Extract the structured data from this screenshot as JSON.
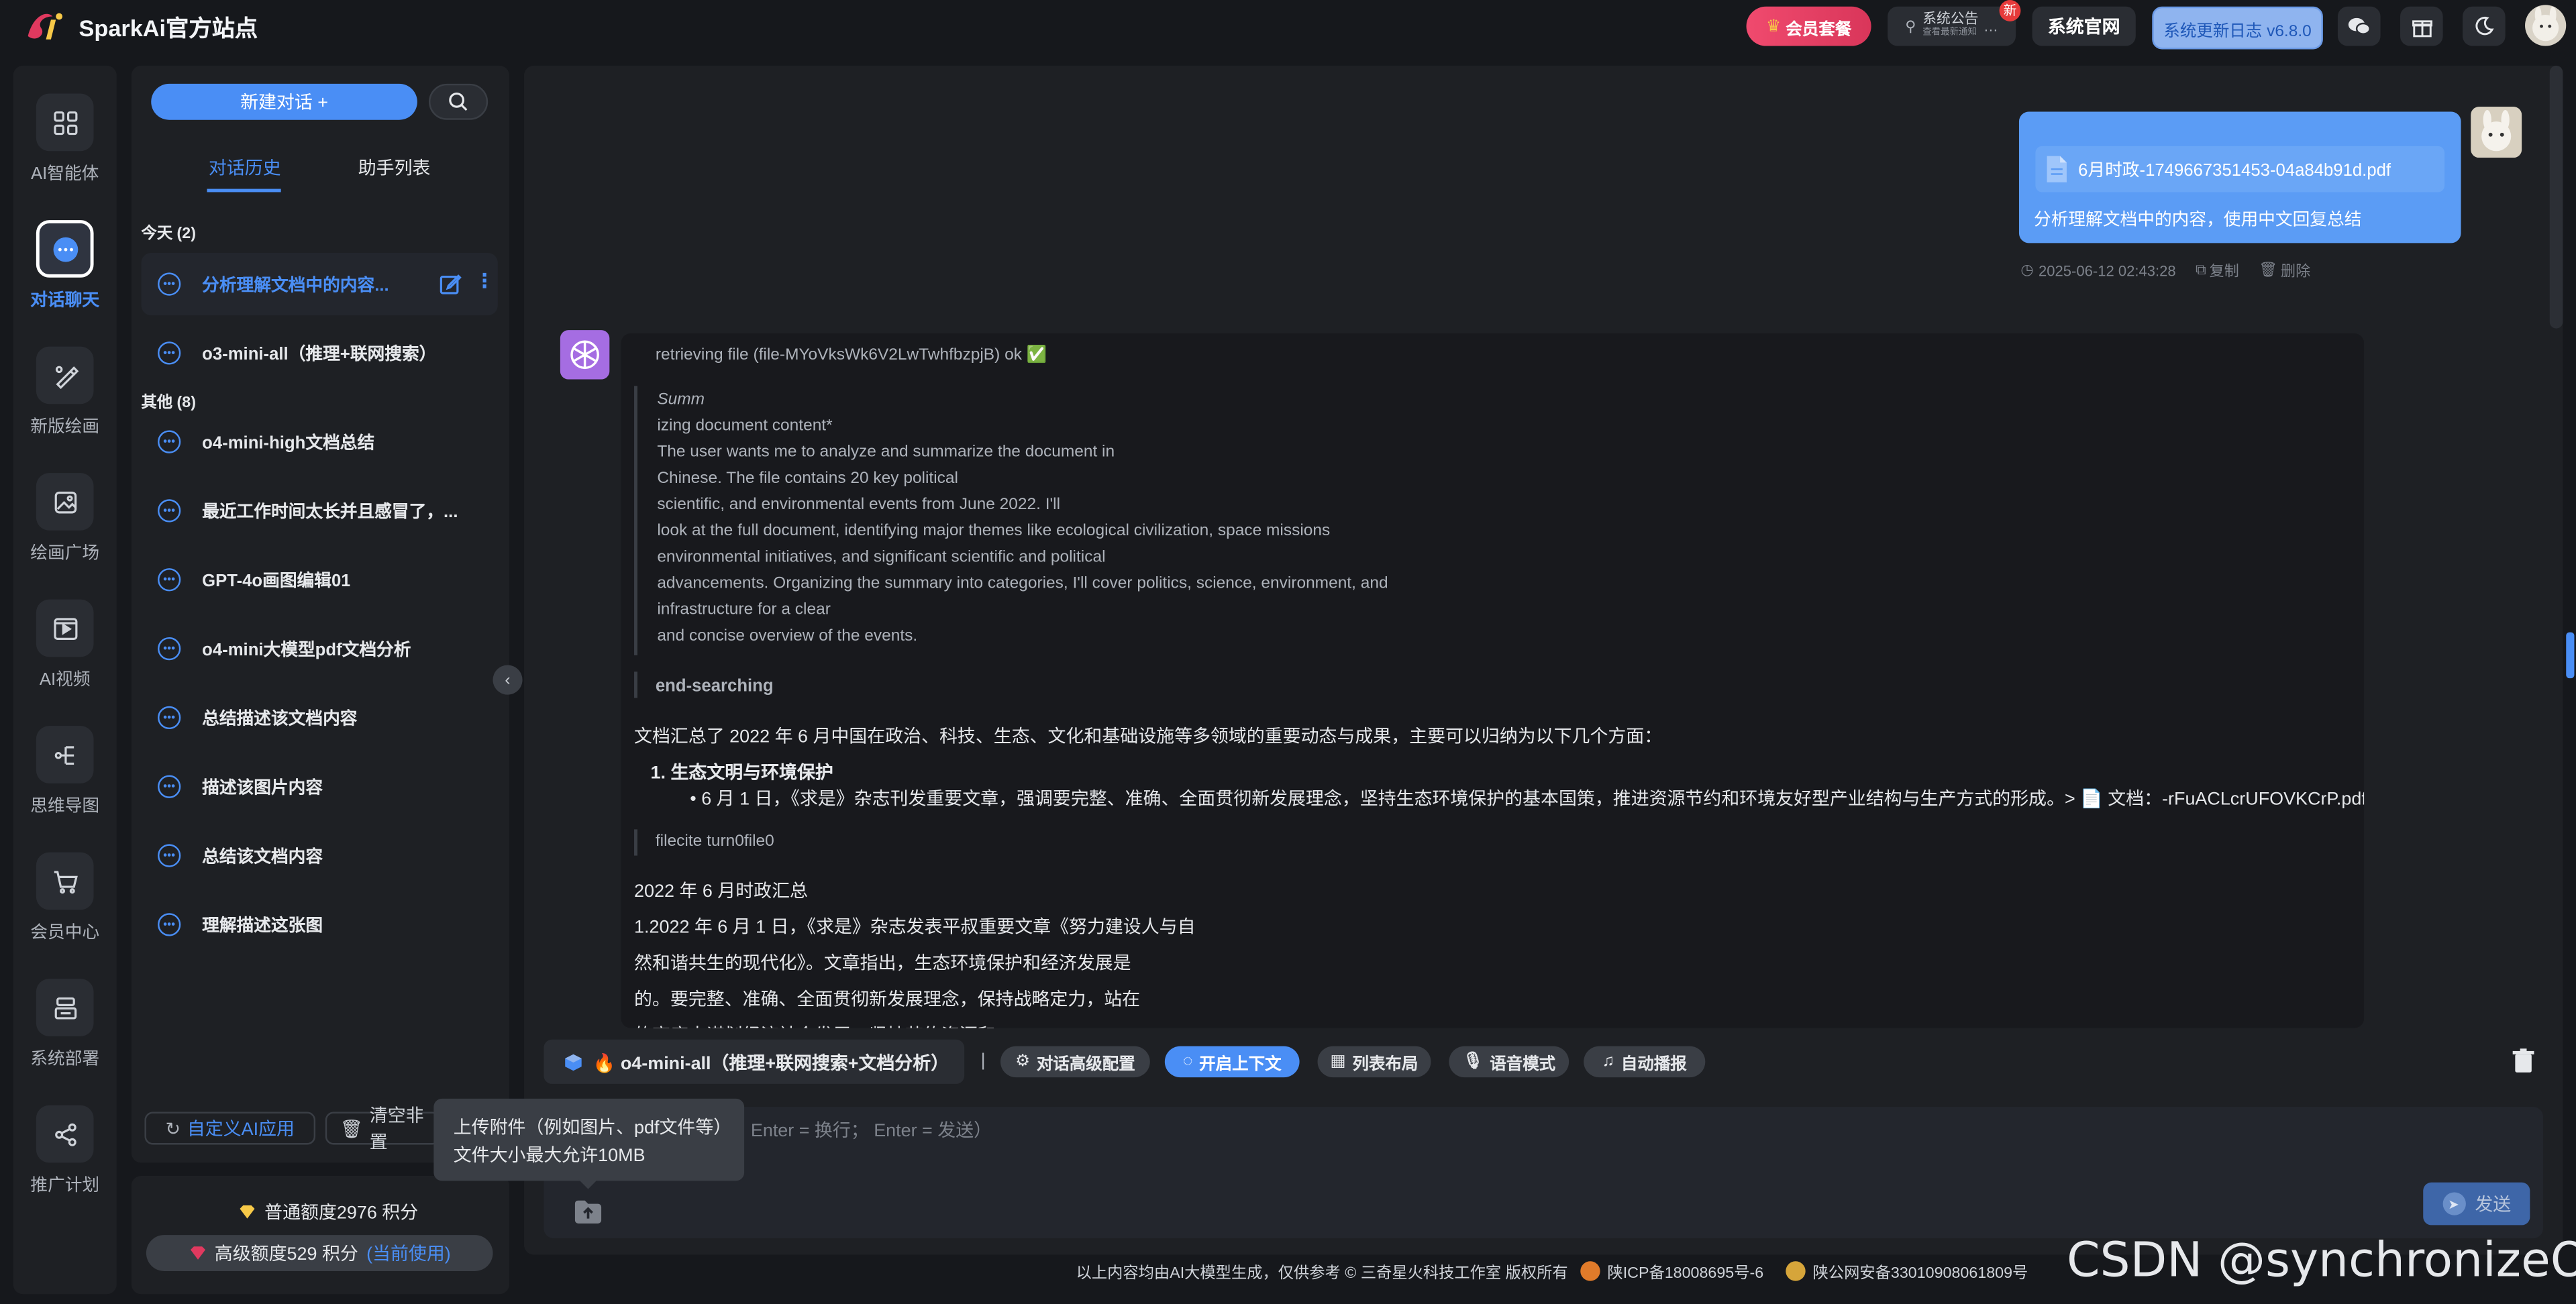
{
  "brand": {
    "name": "SparkAi官方站点"
  },
  "topbar": {
    "vip": "会员套餐",
    "notice_title": "系统公告",
    "notice_sub": "查看最新通知",
    "notice_badge": "新",
    "official": "系统官网",
    "changelog": "系统更新日志 v6.8.0"
  },
  "rail": [
    {
      "label": "AI智能体",
      "icon": "grid-icon"
    },
    {
      "label": "对话聊天",
      "icon": "chat-icon"
    },
    {
      "label": "新版绘画",
      "icon": "brush-icon"
    },
    {
      "label": "绘画广场",
      "icon": "image-gallery-icon"
    },
    {
      "label": "AI视频",
      "icon": "video-icon"
    },
    {
      "label": "思维导图",
      "icon": "mindmap-icon"
    },
    {
      "label": "会员中心",
      "icon": "cart-icon"
    },
    {
      "label": "系统部署",
      "icon": "deploy-icon"
    },
    {
      "label": "推广计划",
      "icon": "share-icon"
    }
  ],
  "sidebar": {
    "new_chat": "新建对话 +",
    "tabs": [
      "对话历史",
      "助手列表"
    ],
    "group_today": "今天 (2)",
    "group_other": "其他 (8)",
    "today": [
      "分析理解文档中的内容...",
      "o3-mini-all（推理+联网搜索）"
    ],
    "other": [
      "o4-mini-high文档总结",
      "最近工作时间太长并且感冒了，...",
      "GPT-4o画图编辑01",
      "o4-mini大模型pdf文档分析",
      "总结描述该文档内容",
      "描述该图片内容",
      "总结该文档内容",
      "理解描述这张图"
    ],
    "custom_app": "自定义AI应用",
    "clear": "清空非置"
  },
  "quota": {
    "normal": "普通额度2976 积分",
    "advanced": "高级额度529 积分",
    "current": "(当前使用)"
  },
  "user_message": {
    "file": "6月时政-1749667351453-04a84b91d.pdf",
    "text": "分析理解文档中的内容，使用中文回复总结",
    "time": "2025-06-12 02:43:28",
    "copy": "复制",
    "delete": "删除"
  },
  "bot_message": {
    "retrieving": "retrieving file (file-MYoVksWk6V2LwTwhfbzpjB) ok ✅",
    "quote": [
      "Summ",
      "izing document content*",
      "The user wants me to analyze and summarize the document in",
      "Chinese. The file contains 20 key political",
      "scientific, and environmental events from June 2022. I'll",
      "look at the full document, identifying major themes like ecological civilization, space missions",
      "environmental initiatives, and significant scientific and political",
      "advancements. Organizing the summary into categories, I'll cover politics, science, environment, and",
      "infrastructure for a clear",
      "and concise overview of the events."
    ],
    "end_searching": "end-searching",
    "summary_intro": "文档汇总了 2022 年 6 月中国在政治、科技、生态、文化和基础设施等多领域的重要动态与成果，主要可以归纳为以下几个方面：",
    "list_title": "1. 生态文明与环境保护",
    "list_item": "• 6 月 1 日，《求是》杂志刊发重要文章，强调要完整、准确、全面贯彻新发展理念，坚持生态环境保护的基本国策，推进资源节约和环境友好型产业结构与生产方式的形成。> 📄 文档：-rFuACLcrUFOVKCrP.pdf",
    "filecite": "filecite turn0file0",
    "body_lines": [
      "2022 年 6 月时政汇总",
      "1.2022 年 6 月 1 日，《求是》杂志发表平叔重要文章《努力建设人与自",
      "然和谐共生的现代化》。文章指出，生态环境保护和经济发展是",
      "的。要完整、准确、全面贯彻新发展理念，保持战略定力，站在",
      "的高度人谋划经济社会发展，坚持节约资源和..."
    ]
  },
  "toolbar": {
    "model": "🔥 o4-mini-all（推理+联网搜索+文档分析）",
    "pipe": "|",
    "advanced_config": "对话高级配置",
    "context": "开启上下文",
    "layout": "列表布局",
    "voice": "语音模式",
    "autoplay": "自动播报"
  },
  "input": {
    "placeholder": "Enter = 换行；  Enter = 发送）",
    "send": "发送"
  },
  "tooltip": {
    "line1": "上传附件（例如图片、pdf文件等）",
    "line2": "文件大小最大允许10MB"
  },
  "footer": {
    "disclaimer": "以上内容均由AI大模型生成，仅供参考 © 三奇星火科技工作室  版权所有",
    "icp": "陕ICP备18008695号-6",
    "police": "陕公网安备33010908061809号"
  },
  "watermark": "CSDN @synchronizeOn",
  "colors": {
    "accent": "#4a8ef5",
    "bg": "#16181c",
    "panel": "#1e2024",
    "vip": "#e0395f"
  }
}
